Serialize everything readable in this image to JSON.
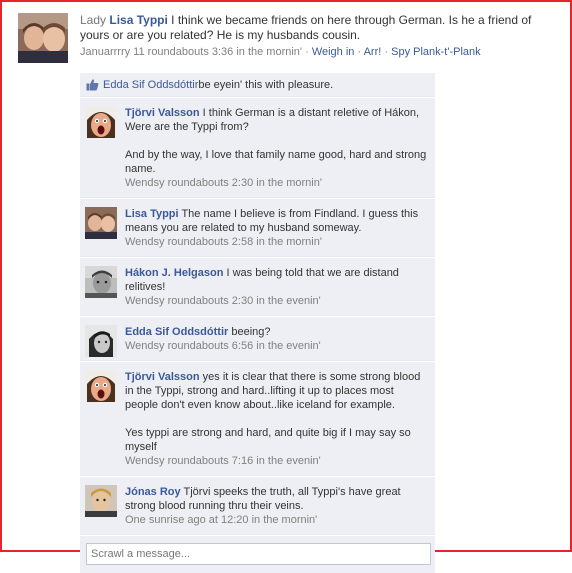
{
  "post": {
    "prefix": "Lady",
    "author": "Lisa Typpi",
    "text": "I think we became friends on here through German. Is he a friend of yours or are you related? He is my husbands cousin.",
    "time": "Januarrrry 11 roundabouts 3:36 in the mornin'",
    "separator": " · ",
    "actions": [
      "Weigh in",
      "Arr!",
      "Spy Plank-t'-Plank"
    ]
  },
  "likes": {
    "name": "Edda Sif Oddsdóttir",
    "text": " be eyein' this with pleasure."
  },
  "comments": [
    {
      "author": "Tjörvi Valsson",
      "paragraphs": [
        "I think German is a distant reletive of Hákon, Were are the Typpi from?",
        "And by the way, I love that family name good, hard and strong name."
      ],
      "time": "Wendsy roundabouts 2:30 in the mornin'"
    },
    {
      "author": "Lisa Typpi",
      "paragraphs": [
        "The name I believe is from Findland. I guess this means you are related to my husband someway."
      ],
      "time": "Wendsy roundabouts 2:58 in the mornin'"
    },
    {
      "author": "Hákon J. Helgason",
      "paragraphs": [
        "I was being told that we are distand relitives!"
      ],
      "time": "Wendsy roundabouts 2:30 in the evenin'"
    },
    {
      "author": "Edda Sif Oddsdóttir",
      "paragraphs": [
        "beeing?"
      ],
      "time": "Wendsy roundabouts 6:56 in the evenin'"
    },
    {
      "author": "Tjörvi Valsson",
      "paragraphs": [
        "yes it is clear that there is some strong blood in the Typpi, strong and hard..lifting it up to places most people don't even know about..like iceland for example.",
        "Yes typpi are strong and hard, and quite big if I may say so myself"
      ],
      "time": "Wendsy roundabouts 7:16 in the evenin'"
    },
    {
      "author": "Jónas Roy",
      "paragraphs": [
        "Tjörvi speeks the truth, all Typpi's have great strong blood running thru their veins."
      ],
      "time": "One sunrise ago at 12:20 in the mornin'"
    }
  ],
  "composer": {
    "placeholder": "Scrawl a message..."
  },
  "colors": {
    "link": "#3b5998",
    "panel": "#edeff4",
    "frame": "#e8242a",
    "meta": "#808080"
  },
  "icons": {
    "like": "thumbs-up-icon"
  }
}
